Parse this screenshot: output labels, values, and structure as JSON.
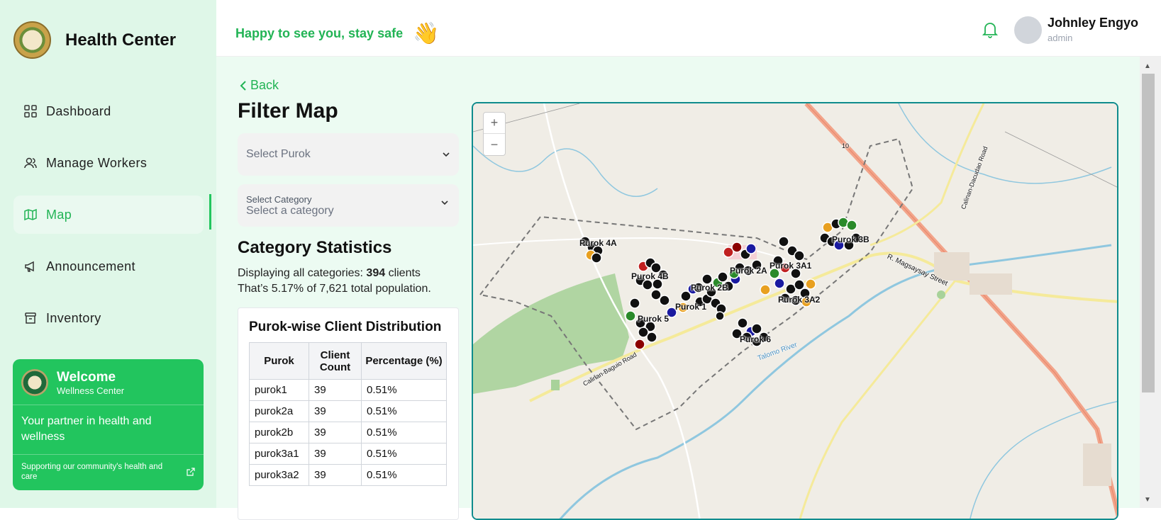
{
  "brand": {
    "title": "Health Center"
  },
  "nav": [
    {
      "label": "Dashboard",
      "icon": "dashboard-icon"
    },
    {
      "label": "Manage Workers",
      "icon": "users-icon"
    },
    {
      "label": "Map",
      "icon": "map-icon",
      "active": true
    },
    {
      "label": "Announcement",
      "icon": "megaphone-icon"
    },
    {
      "label": "Inventory",
      "icon": "archive-icon"
    }
  ],
  "welcome": {
    "title": "Welcome",
    "subtitle": "Wellness Center",
    "body": "Your partner in health and wellness",
    "footer": "Supporting our community's health and care"
  },
  "topbar": {
    "greeting": "Happy to see you, stay safe",
    "user_name": "Johnley Engyo",
    "user_role": "admin"
  },
  "page": {
    "back_label": "Back",
    "title": "Filter Map",
    "select_purok_placeholder": "Select Purok",
    "select_category_label": "Select Category",
    "select_category_placeholder": "Select a category",
    "stats_title": "Category Statistics",
    "stats_line1_prefix": "Displaying all categories: ",
    "stats_count": "394",
    "stats_line1_suffix": " clients",
    "stats_line2": "That’s 5.17% of 7,621 total population.",
    "table_title": "Purok-wise Client Distribution",
    "table_headers": [
      "Purok",
      "Client Count",
      "Percentage (%)"
    ],
    "table_rows": [
      [
        "purok1",
        "39",
        "0.51%"
      ],
      [
        "purok2a",
        "39",
        "0.51%"
      ],
      [
        "purok2b",
        "39",
        "0.51%"
      ],
      [
        "purok3a1",
        "39",
        "0.51%"
      ],
      [
        "purok3a2",
        "39",
        "0.51%"
      ]
    ]
  },
  "map": {
    "zoom_in": "+",
    "zoom_out": "−",
    "purok_labels": [
      "Purok 4A",
      "Purok 4B",
      "Purok 2A",
      "Purok 3A1",
      "Purok 2B",
      "Purok 1",
      "Purok 3A2",
      "Purok 5",
      "Purok 6",
      "Purok 3B"
    ],
    "road_labels": [
      "R. Magsaysay Street",
      "Calinan-Baguio Road",
      "Calinan-Dacudao Road",
      "Talomo River",
      "10"
    ]
  },
  "colors": {
    "accent": "#22c55e",
    "map_border": "#0f8b8d"
  }
}
